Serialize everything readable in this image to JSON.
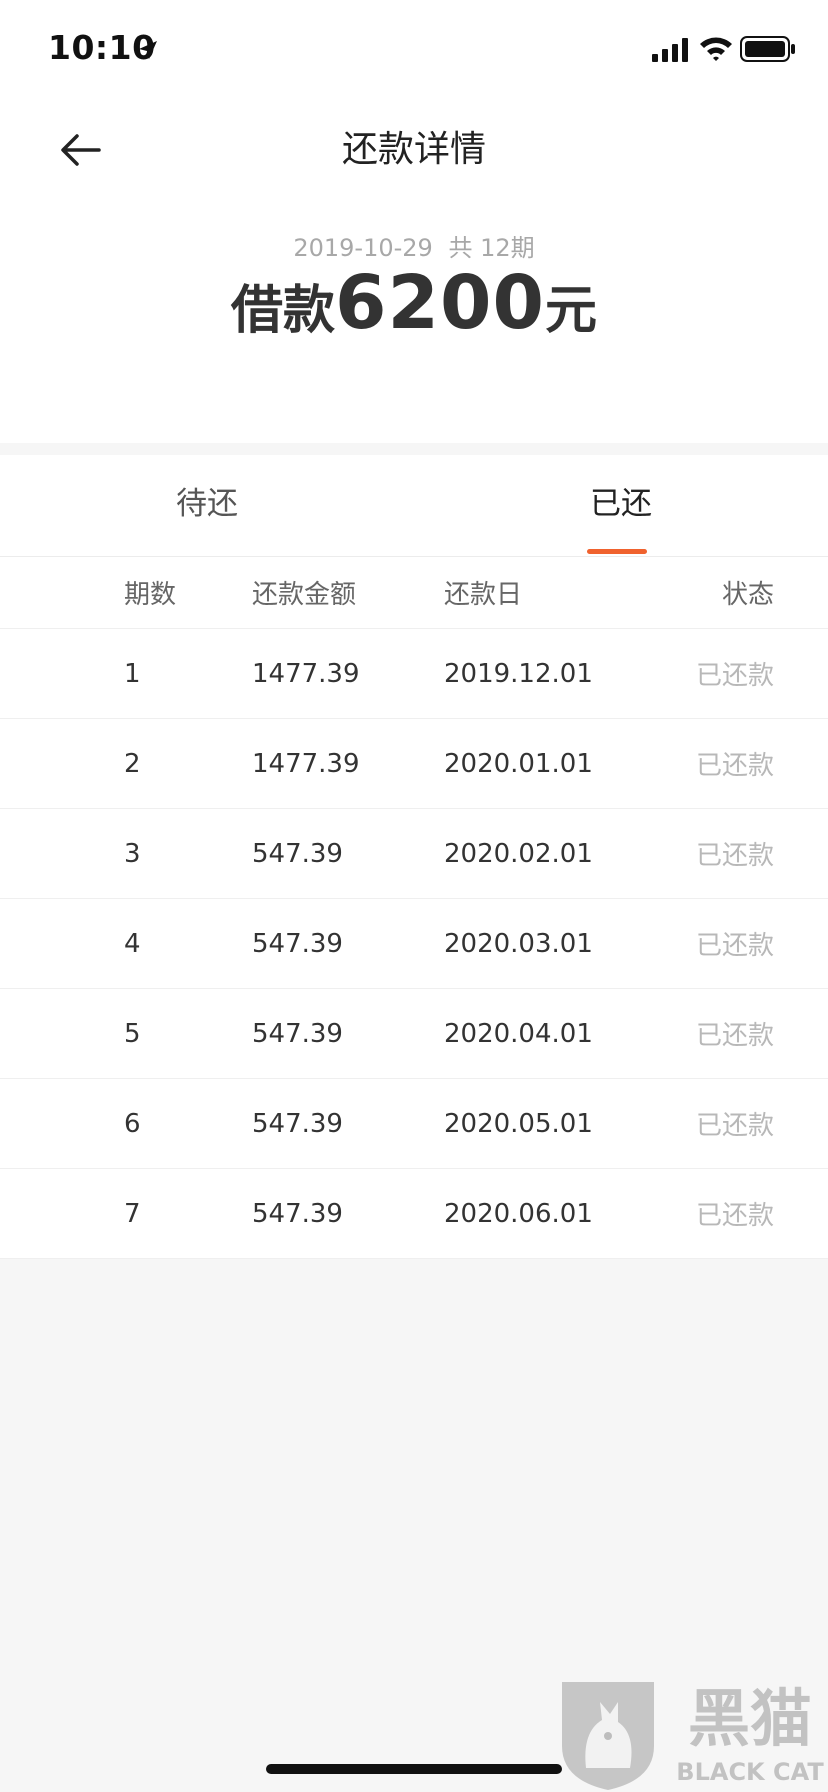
{
  "status_bar": {
    "time": "10:10",
    "icons": [
      "location-arrow-icon",
      "cellular-signal-icon",
      "wifi-icon",
      "battery-icon"
    ]
  },
  "nav": {
    "title": "还款详情",
    "back_icon": "arrow-left-icon"
  },
  "summary": {
    "date": "2019-10-29",
    "total_periods": "共 12期",
    "loan_prefix": "借款",
    "loan_amount": "6200",
    "loan_unit": "元"
  },
  "tabs": [
    {
      "label": "待还",
      "active": false
    },
    {
      "label": "已还",
      "active": true
    }
  ],
  "colors": {
    "accent": "#f0622e",
    "muted": "#b8b8b8"
  },
  "table": {
    "headers": [
      "期数",
      "还款金额",
      "还款日",
      "状态"
    ],
    "rows": [
      {
        "term": "1",
        "amount": "1477.39",
        "date": "2019.12.01",
        "status": "已还款"
      },
      {
        "term": "2",
        "amount": "1477.39",
        "date": "2020.01.01",
        "status": "已还款"
      },
      {
        "term": "3",
        "amount": "547.39",
        "date": "2020.02.01",
        "status": "已还款"
      },
      {
        "term": "4",
        "amount": "547.39",
        "date": "2020.03.01",
        "status": "已还款"
      },
      {
        "term": "5",
        "amount": "547.39",
        "date": "2020.04.01",
        "status": "已还款"
      },
      {
        "term": "6",
        "amount": "547.39",
        "date": "2020.05.01",
        "status": "已还款"
      },
      {
        "term": "7",
        "amount": "547.39",
        "date": "2020.06.01",
        "status": "已还款"
      }
    ]
  },
  "watermark": {
    "brand": "黑猫",
    "brand_en": "BLACK CAT",
    "icon": "black-cat-logo-icon"
  }
}
